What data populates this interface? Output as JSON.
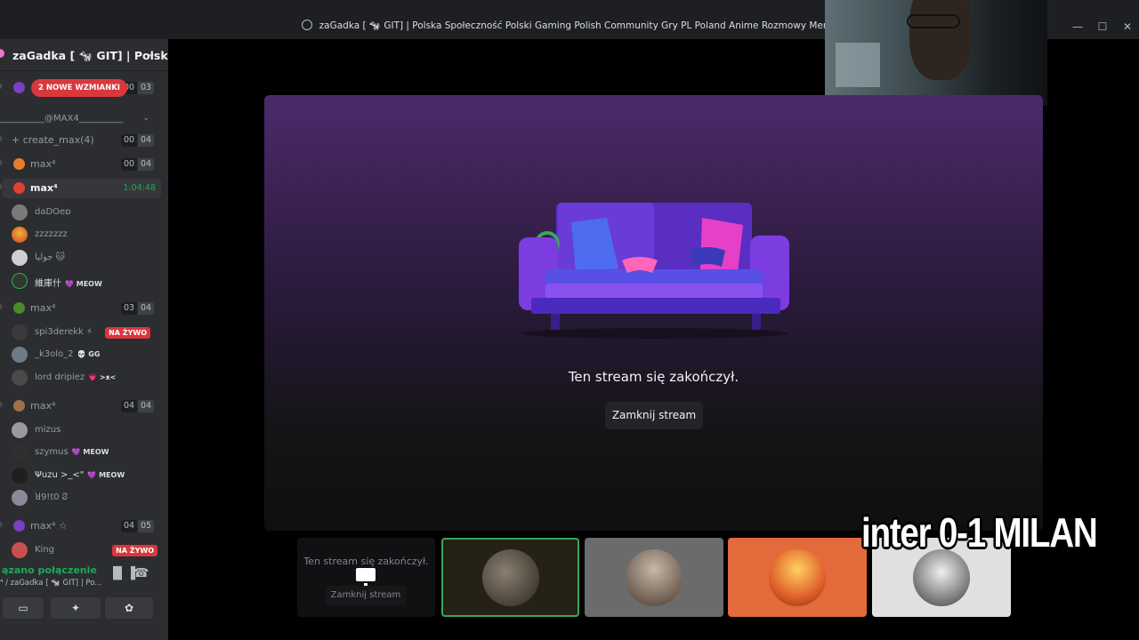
{
  "window": {
    "title": "zaGadka [ 🐄 GIT] | Polska Społeczność Polski Gaming Polish Community Gry PL Poland Anime Rozmowy Memy"
  },
  "sidebar": {
    "server_name": "zaGadka [ 🐄 GIT] | Polsk...",
    "mentions_pill": "2 NOWE WZMIANKI",
    "top_counts": [
      "00",
      "03"
    ],
    "category": "__________@MAX4__________",
    "channels": [
      {
        "name": "+ create_max(4)",
        "counts": [
          "00",
          "04"
        ]
      },
      {
        "name": "max⁴",
        "icon_color": "#e87c2a",
        "counts": [
          "00",
          "04"
        ]
      },
      {
        "name": "max⁴",
        "icon_color": "#e0402e",
        "timer": "1:04:48",
        "active": true
      }
    ],
    "members_1": [
      {
        "name": "daDOeɒ",
        "avatar": "#7a7a7a"
      },
      {
        "name": "zzzzzzz",
        "avatar": "#e06a2c"
      },
      {
        "name": "جوليا 🐱",
        "avatar": "#cfcfcf"
      },
      {
        "name": "維庫什",
        "tag": "💜 MEOW",
        "avatar": "#2d3b2f"
      }
    ],
    "channel_2": {
      "name": "max⁴",
      "counts": [
        "03",
        "04"
      ]
    },
    "members_2": [
      {
        "name": "spi3derekk ⚡",
        "live": "NA ŻYWO",
        "avatar": "#3a3a3a"
      },
      {
        "name": "_k3olo_2",
        "tag": "💀 GG",
        "avatar": "#6f7a88"
      },
      {
        "name": "lord dripiez",
        "tag": "💗 >ᴥ<",
        "avatar": "#4a4a4a"
      }
    ],
    "channel_3": {
      "name": "max⁴",
      "counts": [
        "04",
        "04"
      ]
    },
    "members_3": [
      {
        "name": "mizus",
        "avatar": "#9a9a9a"
      },
      {
        "name": "szymus",
        "tag": "💜 MEOW",
        "avatar": "#2f2f2f"
      },
      {
        "name": "Ψuzu >_<\"",
        "tag": "💜 MEOW",
        "avatar": "#1f1f1f"
      },
      {
        "name": "ꓤ9!t0 ꗟ",
        "avatar": "#8a8a9a"
      }
    ],
    "channel_4": {
      "name": "max⁴ ☆",
      "counts": [
        "04",
        "05"
      ]
    },
    "members_4": [
      {
        "name": "King",
        "live": "NA ŻYWO",
        "avatar": "#c94f4f"
      }
    ],
    "voice": {
      "status": "ązano połączenie",
      "channel": "⁴ / zaGadka [ 🐄 GIT] | Po..."
    }
  },
  "stage": {
    "message": "Ten stream się zakończył.",
    "close_button": "Zamknij stream"
  },
  "thumbnails": {
    "ended_text": "Ten stream się zakończył.",
    "ended_button": "Zamknij stream"
  },
  "overlay": {
    "score_text": "inter 0-1 MILAN"
  },
  "colors": {
    "accent_green": "#23a55a",
    "live_red": "#da373c",
    "sidebar_bg": "#2b2d31"
  }
}
